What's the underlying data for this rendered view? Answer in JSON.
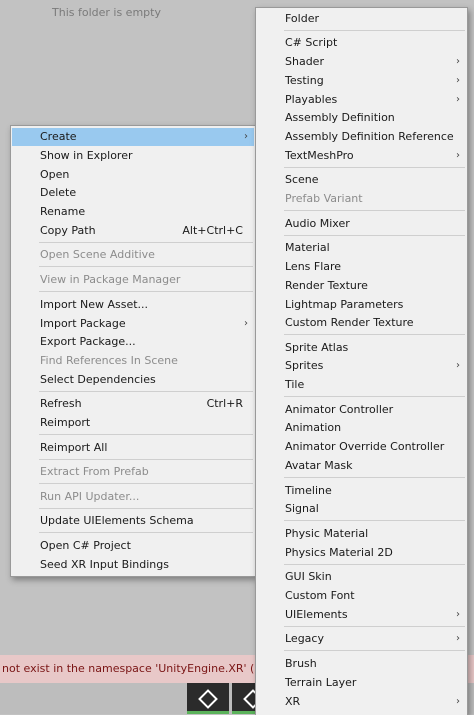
{
  "background": {
    "empty_text": "This folder is empty",
    "console_message": "not exist in the namespace 'UnityEngine.XR' (are you m"
  },
  "colors": {
    "highlight": "#99c9ef",
    "menu_bg": "#f0f0f0",
    "console_bg": "#e8c8c8"
  },
  "context_menu": {
    "create": "Create",
    "show_in_explorer": "Show in Explorer",
    "open": "Open",
    "delete": "Delete",
    "rename": "Rename",
    "copy_path": "Copy Path",
    "copy_path_shortcut": "Alt+Ctrl+C",
    "open_scene_additive": "Open Scene Additive",
    "view_in_package_manager": "View in Package Manager",
    "import_new_asset": "Import New Asset...",
    "import_package": "Import Package",
    "export_package": "Export Package...",
    "find_references": "Find References In Scene",
    "select_dependencies": "Select Dependencies",
    "refresh": "Refresh",
    "refresh_shortcut": "Ctrl+R",
    "reimport": "Reimport",
    "reimport_all": "Reimport All",
    "extract_from_prefab": "Extract From Prefab",
    "run_api_updater": "Run API Updater...",
    "update_uielements_schema": "Update UIElements Schema",
    "open_csharp_project": "Open C# Project",
    "seed_xr_input_bindings": "Seed XR Input Bindings"
  },
  "create_submenu": {
    "folder": "Folder",
    "csharp_script": "C# Script",
    "shader": "Shader",
    "testing": "Testing",
    "playables": "Playables",
    "assembly_definition": "Assembly Definition",
    "assembly_definition_reference": "Assembly Definition Reference",
    "textmeshpro": "TextMeshPro",
    "scene": "Scene",
    "prefab_variant": "Prefab Variant",
    "audio_mixer": "Audio Mixer",
    "material": "Material",
    "lens_flare": "Lens Flare",
    "render_texture": "Render Texture",
    "lightmap_parameters": "Lightmap Parameters",
    "custom_render_texture": "Custom Render Texture",
    "sprite_atlas": "Sprite Atlas",
    "sprites": "Sprites",
    "tile": "Tile",
    "animator_controller": "Animator Controller",
    "animation": "Animation",
    "animator_override_controller": "Animator Override Controller",
    "avatar_mask": "Avatar Mask",
    "timeline": "Timeline",
    "signal": "Signal",
    "physic_material": "Physic Material",
    "physics_material_2d": "Physics Material 2D",
    "gui_skin": "GUI Skin",
    "custom_font": "Custom Font",
    "uielements": "UIElements",
    "legacy": "Legacy",
    "brush": "Brush",
    "terrain_layer": "Terrain Layer",
    "xr": "XR"
  },
  "icons": {
    "submenu_arrow": "chevron-right-icon",
    "taskbar": "unity-logo-icon"
  }
}
